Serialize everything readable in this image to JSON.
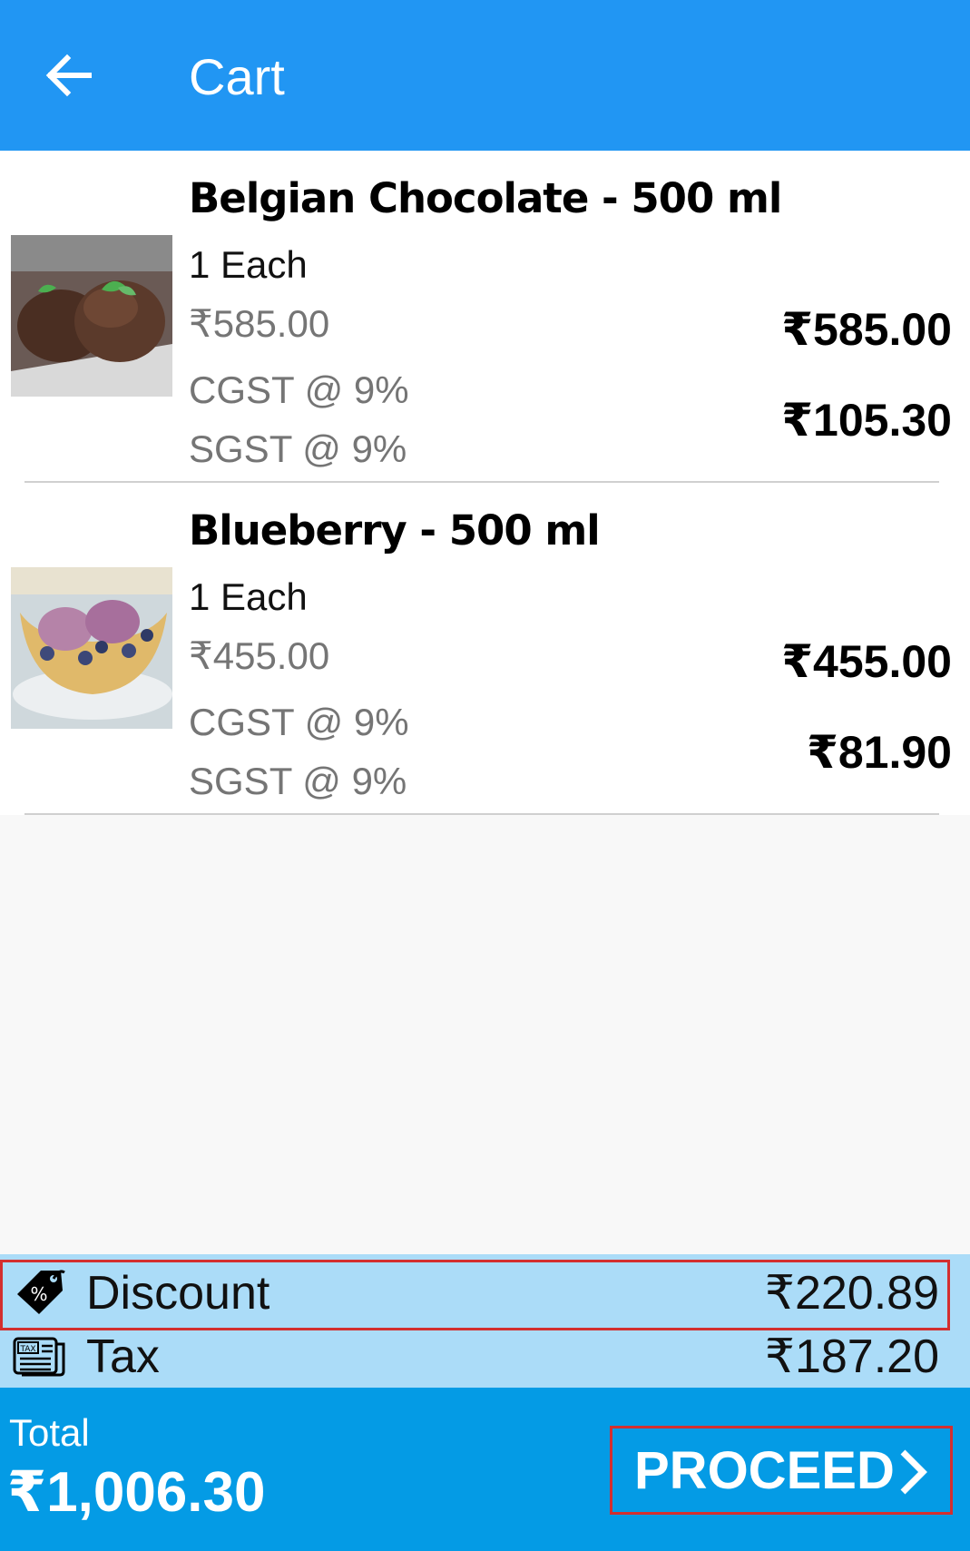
{
  "appbar": {
    "title": "Cart"
  },
  "items": [
    {
      "name": "Belgian Chocolate - 500 ml",
      "qty": "1 Each",
      "unit_price": "₹585.00",
      "cgst": "CGST @ 9%",
      "sgst": "SGST @ 9%",
      "line_price": "₹585.00",
      "tax_amount": "₹105.30",
      "thumb": "chocolate-ice-cream-image"
    },
    {
      "name": "Blueberry - 500 ml",
      "qty": "1 Each",
      "unit_price": "₹455.00",
      "cgst": "CGST @ 9%",
      "sgst": "SGST @ 9%",
      "line_price": "₹455.00",
      "tax_amount": "₹81.90",
      "thumb": "blueberry-ice-cream-image"
    }
  ],
  "summary": {
    "discount_label": "Discount",
    "discount_amount": "₹220.89",
    "tax_label": "Tax",
    "tax_amount": "₹187.20",
    "discount_icon": "discount-tag-icon",
    "tax_icon": "tax-receipt-icon",
    "tax_icon_text": "TAX",
    "discount_icon_text": "%"
  },
  "footer": {
    "total_label": "Total",
    "total_value": "₹1,006.30",
    "proceed_label": "PROCEED"
  },
  "colors": {
    "appbar": "#2196F3",
    "summary_bg": "#ABDCF8",
    "footer_bg": "#049BE5",
    "highlight": "#d32f2f"
  }
}
